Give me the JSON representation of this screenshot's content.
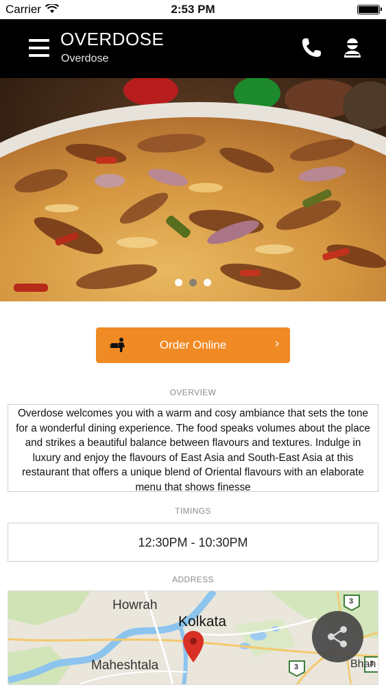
{
  "status_bar": {
    "carrier": "Carrier",
    "time": "2:53 PM"
  },
  "header": {
    "title": "OVERDOSE",
    "subtitle": "Overdose",
    "icons": [
      "menu-icon",
      "phone-icon",
      "profile-icon"
    ]
  },
  "carousel": {
    "slide_count": 3,
    "active_index": 2
  },
  "order_button": {
    "label": "Order Online",
    "chevron": "›",
    "icon": "delivery-icon",
    "color": "#f08a24"
  },
  "overview": {
    "heading": "OVERVIEW",
    "text": "Overdose welcomes you with a warm and cosy ambiance that sets the tone for a wonderful dining experience. The food speaks volumes about the place and strikes a beautiful balance between flavours and textures. Indulge in luxury and enjoy the flavours of East Asia and South-East Asia at this restaurant that offers a unique blend of Oriental flavours with an elaborate menu that shows finesse"
  },
  "timings": {
    "heading": "TIMINGS",
    "value": "12:30PM - 10:30PM"
  },
  "address": {
    "heading": "ADDRESS",
    "map_labels": {
      "howrah": "Howrah",
      "kolkata": "Kolkata",
      "maheshtala": "Maheshtala",
      "bhangar": "Bhan",
      "road_3a": "3",
      "road_3b": "3",
      "road_3c": "3"
    }
  },
  "share_button": {
    "icon": "share-icon"
  },
  "colors": {
    "header_bg": "#000000",
    "accent": "#f08a24",
    "pin": "#d93025"
  }
}
